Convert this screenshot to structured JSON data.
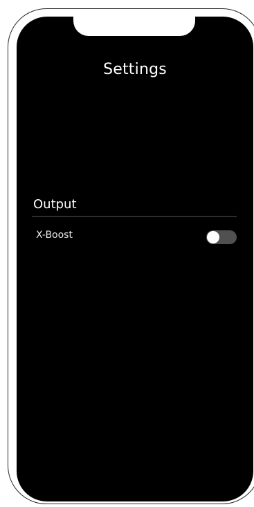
{
  "header": {
    "title": "Settings"
  },
  "sections": [
    {
      "title": "Output",
      "items": [
        {
          "label": "X-Boost",
          "type": "toggle",
          "enabled": false
        }
      ]
    }
  ],
  "colors": {
    "background": "#000000",
    "text": "#ffffff",
    "divider": "#2e2e2e",
    "toggle_track_off": "#505050",
    "toggle_knob": "#ffffff",
    "device_frame": "#ffffff"
  }
}
